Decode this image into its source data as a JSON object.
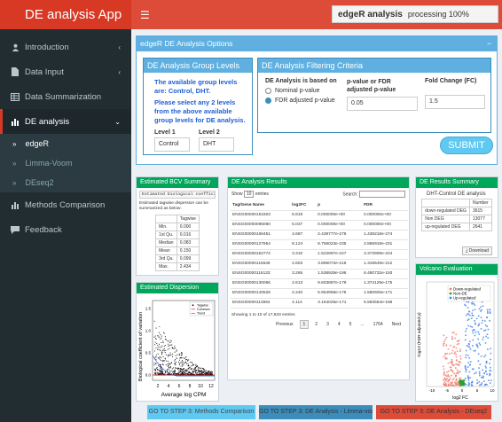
{
  "app": {
    "title": "DE analysis App"
  },
  "sidebar": {
    "items": [
      {
        "label": "Introduction",
        "icon": "user-icon"
      },
      {
        "label": "Data Input",
        "icon": "file-icon"
      },
      {
        "label": "Data Summarization",
        "icon": "table-icon"
      },
      {
        "label": "DE analysis",
        "icon": "bar-chart-icon"
      }
    ],
    "sub_items": [
      "edgeR",
      "Limma-Voom",
      "DEseq2"
    ],
    "items_after": [
      {
        "label": "Methods Comparison",
        "icon": "bar-chart-icon"
      },
      {
        "label": "Feedback",
        "icon": "comment-icon"
      }
    ]
  },
  "header": {
    "progress_title": "edgeR analysis",
    "progress_text": "processing 100%"
  },
  "options": {
    "title": "edgeR DE Analysis Options",
    "group": {
      "title": "DE Analysis Group Levels",
      "text1": "The available group levels are: Control, DHT.",
      "text2": "Please select any 2 levels from the above available group levels for DE analysis.",
      "level1_label": "Level 1",
      "level1_value": "Control",
      "level2_label": "Level 2",
      "level2_value": "DHT"
    },
    "filter": {
      "title": "DE Analysis Filtering Criteria",
      "based_on_label": "DE Analysis is based on",
      "radio1": "Nominal p-value",
      "radio2": "FDR adjusted p-value",
      "pvalue_label": "p-value or FDR adjusted p-value",
      "pvalue_value": "0.05",
      "fc_label": "Fold Change (FC)",
      "fc_value": "1.5"
    },
    "submit_label": "SUBMIT"
  },
  "bcv": {
    "title": "Estimated BCV Summary",
    "code": "Estimated biological coefficient",
    "note": "Estimated tagwise dispersion can be summarized as below:",
    "col": "Tagwise",
    "rows": [
      [
        "Min.",
        "0.000"
      ],
      [
        "1st Qu.",
        "0.016"
      ],
      [
        "Median",
        "0.083"
      ],
      [
        "Mean",
        "0.150"
      ],
      [
        "3rd Qu.",
        "0.099"
      ],
      [
        "Max.",
        "2.434"
      ]
    ]
  },
  "dispersion": {
    "title": "Estimated Dispersion",
    "ylabel": "Biological coefficient of variation",
    "xlabel": "Average log CPM",
    "xticks": [
      "2",
      "4",
      "6",
      "8",
      "10",
      "12"
    ],
    "yticks": [
      "0.0",
      "0.5",
      "1.0",
      "1.5"
    ],
    "legend": [
      "Tagwise",
      "Common",
      "Trend"
    ]
  },
  "results": {
    "title": "DE Analysis Results",
    "show_label": "Show",
    "show_value": "10",
    "entries_label": "entries",
    "search_label": "Search:",
    "columns": [
      "Tag/Gene Name",
      "log2FC",
      "p",
      "FDR"
    ],
    "rows": [
      [
        "ENSG00000151503",
        "5.819",
        "0.000000e+00",
        "0.000000e+00"
      ],
      [
        "ENSG00000096060",
        "5.037",
        "0.000000e+00",
        "0.000000e+00"
      ],
      [
        "ENSG00000166451",
        "4.687",
        "2.439777e-278",
        "1.438218e-274"
      ],
      [
        "ENSG00000127954",
        "8.124",
        "8.756023e-235",
        "2.866918e-231"
      ],
      [
        "ENSG00000162772",
        "3.310",
        "1.522897e-227",
        "3.373909e-224"
      ],
      [
        "ENSG00000115648",
        "2.603",
        "3.896072e-216",
        "1.318549e-212"
      ],
      [
        "ENSG00000116133",
        "3.265",
        "1.536928e-196",
        "6.480732e-193"
      ],
      [
        "ENSG00000130066",
        "2.613",
        "9.603887e-179",
        "1.374129e-175"
      ],
      [
        "ENSG00000140526",
        "2.240",
        "5.954959e-175",
        "1.580925e-171"
      ],
      [
        "ENSG00000113594",
        "4.114",
        "3.164025e-171",
        "5.583554e-168"
      ]
    ],
    "footer": "Showing 1 to 10 of 17,633 entries",
    "pages": [
      "Previous",
      "1",
      "2",
      "3",
      "4",
      "5",
      "...",
      "1764",
      "Next"
    ]
  },
  "summary": {
    "title": "DE Results Summary",
    "subtitle": "DHT-Control DE analysis",
    "col": "Number",
    "rows": [
      [
        "down-regulated DEG",
        "3615"
      ],
      [
        "Non DEG",
        "13077"
      ],
      [
        "up-regulated DEG",
        "2641"
      ]
    ],
    "download": "Download"
  },
  "volcano": {
    "title": "Volcano Evaluation",
    "legend": [
      "Down-regulated",
      "Non-DE",
      "Up-regulated"
    ],
    "colors": [
      "#f08070",
      "#2ca02c",
      "#4a86e8"
    ],
    "ylabel": "-log10 (FDR adjusted p)",
    "xlabel": "log2 FC",
    "xticks": [
      "-10",
      "-5",
      "0",
      "5",
      "10"
    ]
  },
  "bottom_buttons": [
    {
      "label": "GO TO STEP 3: Methods Comparison",
      "color": "#5fc9f2"
    },
    {
      "label": "GO TO STEP 3: DE Analysis - Limma-voom",
      "color": "#3c8dbc"
    },
    {
      "label": "GO TO STEP 3: DE Analysis - DEseq2",
      "color": "#dd4b39"
    }
  ]
}
